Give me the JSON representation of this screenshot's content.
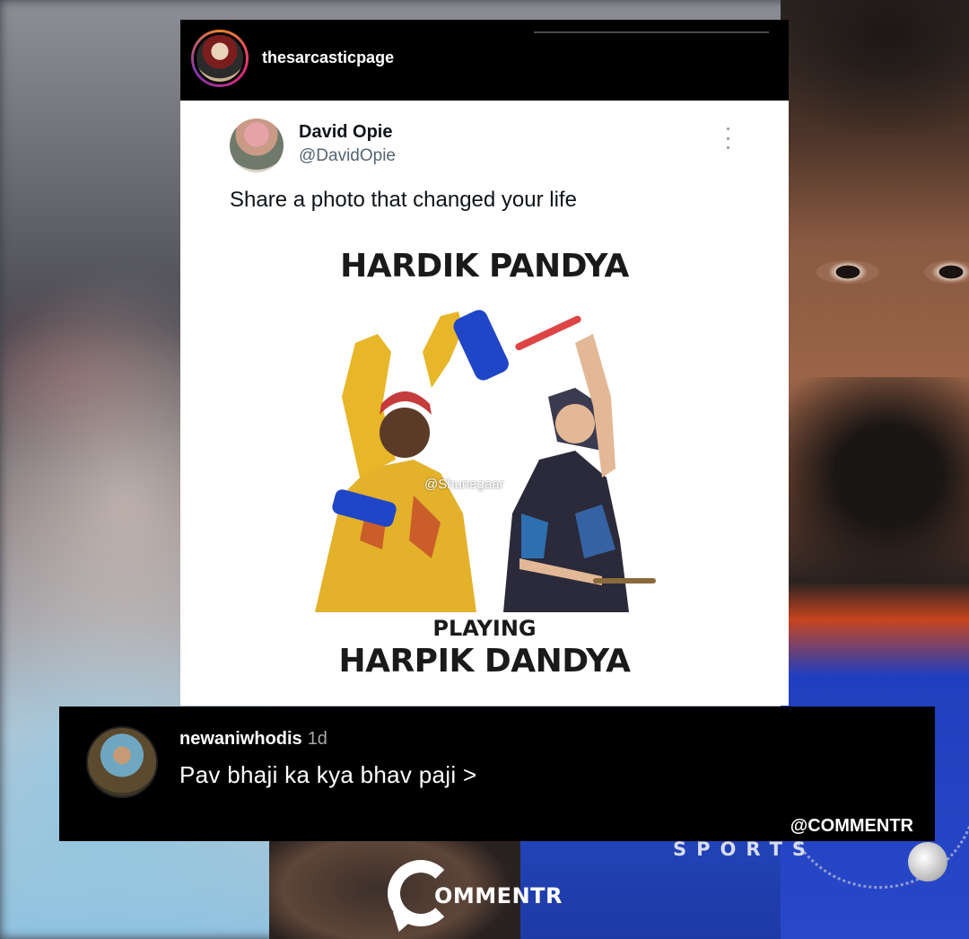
{
  "post": {
    "account": "thesarcasticpage",
    "tweet": {
      "name": "David Opie",
      "handle": "@DavidOpie",
      "text": "Share a photo that changed your life"
    },
    "meme": {
      "top_text": "HARDIK PANDYA",
      "middle_text": "PLAYING",
      "bottom_text": "HARPIK DANDYA",
      "watermark": "@Shunegaar"
    }
  },
  "comment": {
    "username": "newaniwhodis",
    "time": "1d",
    "text": "Pav bhaji ka kya bhav paji >",
    "credit": "@COMMENTR"
  },
  "background": {
    "jersey_text": "SPORTS"
  },
  "logo": {
    "text": "OMMENTR"
  }
}
